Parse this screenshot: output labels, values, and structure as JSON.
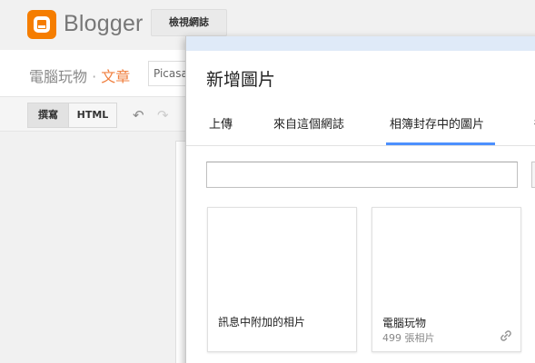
{
  "header": {
    "brand": "Blogger",
    "view_blog_label": "檢視網誌"
  },
  "post": {
    "blog_name": "電腦玩物",
    "separator": "·",
    "kind": "文章",
    "title_value": "Picasa"
  },
  "toolbar": {
    "compose_label": "撰寫",
    "html_label": "HTML"
  },
  "dialog": {
    "title": "新增圖片",
    "tabs": [
      {
        "label": "上傳"
      },
      {
        "label": "來自這個網誌"
      },
      {
        "label": "相簿封存中的圖片",
        "selected": true
      },
      {
        "label": "從"
      }
    ],
    "search": {
      "value": ""
    },
    "albums": [
      {
        "name": "訊息中附加的相片",
        "count": ""
      },
      {
        "name": "電腦玩物",
        "count": "499 張相片"
      }
    ]
  },
  "colors": {
    "brand_orange": "#f57d00",
    "accent_blue": "#4d90fe",
    "post_kind": "#f08040"
  }
}
